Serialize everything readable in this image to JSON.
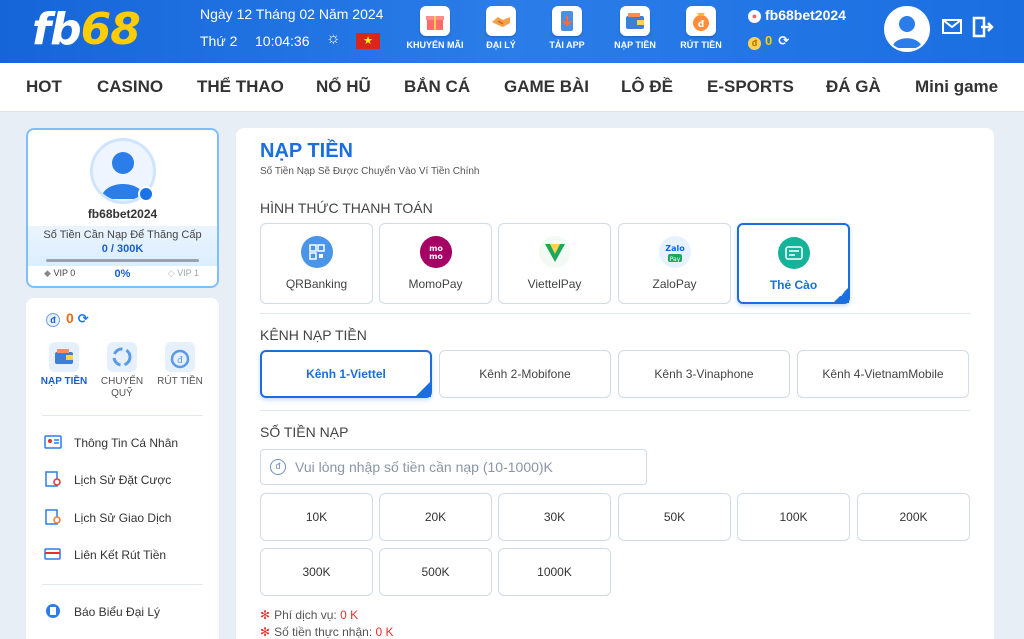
{
  "header": {
    "logo_a": "fb",
    "logo_b": "68",
    "date": "Ngày 12 Tháng 02 Năm 2024",
    "weekday": "Thứ 2",
    "time": "10:04:36",
    "nav": [
      {
        "label": "KHUYẾN MÃI",
        "icon": "gift-icon"
      },
      {
        "label": "ĐẠI LÝ",
        "icon": "handshake-icon"
      },
      {
        "label": "TẢI APP",
        "icon": "download-app-icon"
      },
      {
        "label": "NẠP TIỀN",
        "icon": "wallet-icon"
      },
      {
        "label": "RÚT TIỀN",
        "icon": "money-bag-icon"
      }
    ],
    "username": "fb68bet2024",
    "balance": "0",
    "colors": {
      "header_bg": "#1565d8",
      "logo_accent": "#ffcc00"
    }
  },
  "menu": [
    "HOT",
    "CASINO",
    "THỂ THAO",
    "NỔ HŨ",
    "BẮN CÁ",
    "GAME BÀI",
    "LÔ ĐỀ",
    "E-SPORTS",
    "ĐÁ GÀ",
    "Mini game"
  ],
  "profile": {
    "username": "fb68bet2024",
    "upgrade_label": "Số Tiền Cần Nạp Để Thăng Cấp",
    "upgrade_value": "0 / 300K",
    "vip_current": "VIP 0",
    "percent": "0%",
    "vip_next": "VIP 1"
  },
  "sidebar": {
    "balance": "0",
    "quick_actions": [
      {
        "label": "NẠP TIỀN",
        "icon": "wallet-icon",
        "active": true
      },
      {
        "label": "CHUYỂN QUỸ",
        "icon": "transfer-icon",
        "active": false
      },
      {
        "label": "RÚT TIỀN",
        "icon": "money-bag-icon",
        "active": false
      }
    ],
    "links": [
      {
        "label": "Thông Tin Cá Nhân",
        "icon": "id-card-icon"
      },
      {
        "label": "Lịch Sử Đặt Cược",
        "icon": "bet-history-icon"
      },
      {
        "label": "Lịch Sử Giao Dịch",
        "icon": "transaction-history-icon"
      },
      {
        "label": "Liên Kết Rút Tiền",
        "icon": "bank-card-icon"
      },
      {
        "label": "Báo Biểu Đại Lý",
        "icon": "report-icon"
      }
    ]
  },
  "deposit": {
    "title": "NẠP TIỀN",
    "subtitle": "Số Tiền Nạp Sẽ Được Chuyển Vào Ví Tiền Chính",
    "method_heading": "HÌNH THỨC THANH TOÁN",
    "methods": [
      {
        "label": "QRBanking",
        "icon": "qr-code-icon",
        "color": "#3d8ee6"
      },
      {
        "label": "MomoPay",
        "icon": "momo-icon",
        "color": "#a50064"
      },
      {
        "label": "ViettelPay",
        "icon": "viettelpay-icon",
        "color": "#1ca85c"
      },
      {
        "label": "ZaloPay",
        "icon": "zalopay-icon",
        "color": "#0068ff"
      },
      {
        "label": "Thẻ Cào",
        "icon": "scratch-card-icon",
        "color": "#16b39a",
        "selected": true
      }
    ],
    "channel_heading": "KÊNH NẠP TIỀN",
    "channels": [
      {
        "label": "Kênh 1-Viettel",
        "selected": true
      },
      {
        "label": "Kênh 2-Mobifone"
      },
      {
        "label": "Kênh 3-Vinaphone"
      },
      {
        "label": "Kênh 4-VietnamMobile"
      }
    ],
    "amount_heading": "SỐ TIỀN NẠP",
    "amount_placeholder": "Vui lòng nhập số tiền cần nạp (10-1000)K",
    "amounts": [
      "10K",
      "20K",
      "30K",
      "50K",
      "100K",
      "200K",
      "300K",
      "500K",
      "1000K"
    ],
    "fee_label": "Phí dịch vụ:",
    "fee_value": "0 K",
    "received_label": "Số tiền thực nhận:",
    "received_value": "0 K"
  }
}
